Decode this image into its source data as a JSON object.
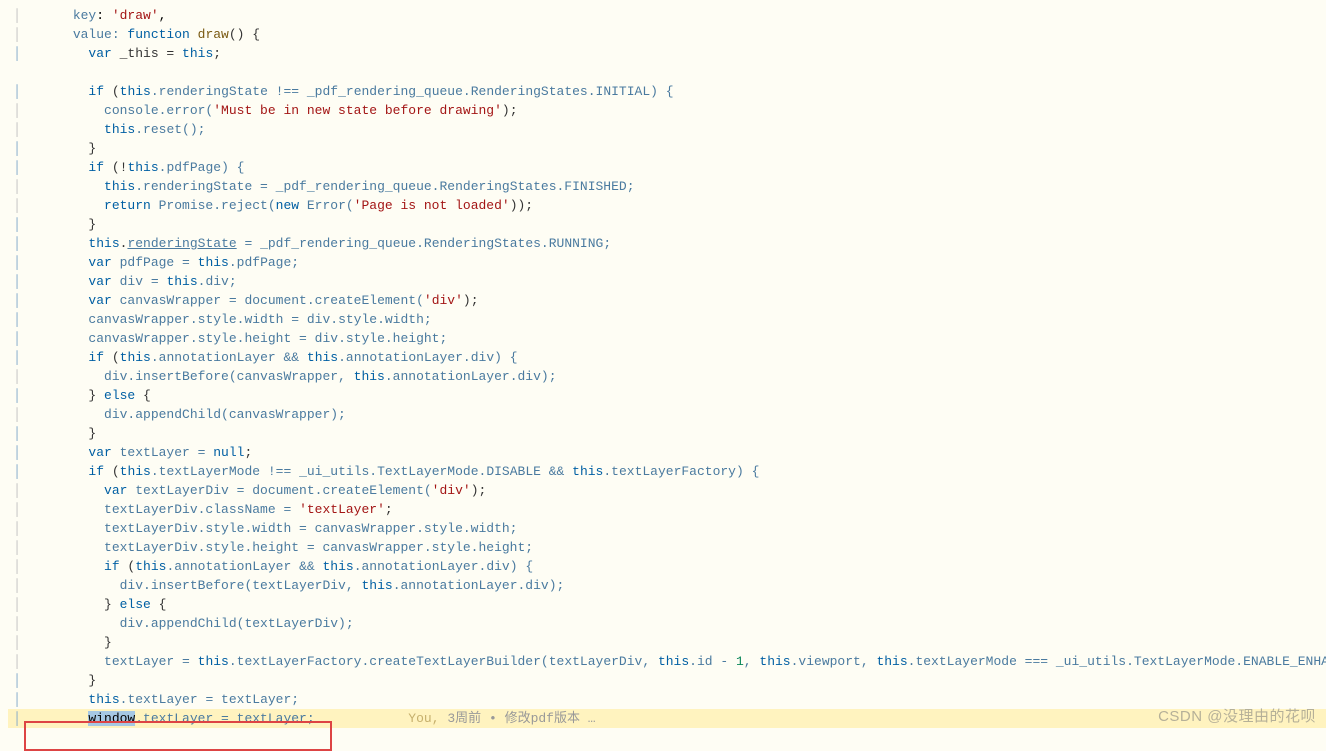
{
  "code": {
    "l1": "key: 'draw',",
    "l2a": "value: ",
    "l2b": "function",
    "l2c": " draw() {",
    "l3a": "var",
    "l3b": " _this = ",
    "l3c": "this",
    "l3d": ";",
    "l4": "",
    "l5a": "if",
    "l5b": " (",
    "l5c": "this",
    "l5d": ".renderingState !== _pdf_rendering_queue.RenderingStates.INITIAL) {",
    "l6a": "console.error(",
    "l6b": "'Must be in new state before drawing'",
    "l6c": ");",
    "l7a": "this",
    "l7b": ".reset();",
    "l8": "}",
    "l9a": "if",
    "l9b": " (!",
    "l9c": "this",
    "l9d": ".pdfPage) {",
    "l10a": "this",
    "l10b": ".renderingState = _pdf_rendering_queue.RenderingStates.FINISHED;",
    "l11a": "return",
    "l11b": " Promise.reject(",
    "l11c": "new",
    "l11d": " Error(",
    "l11e": "'Page is not loaded'",
    "l11f": "));",
    "l12": "}",
    "l13a": "this",
    "l13b": ".",
    "l13c": "renderingState",
    "l13d": " = _pdf_rendering_queue.RenderingStates.RUNNING;",
    "l14a": "var",
    "l14b": " pdfPage = ",
    "l14c": "this",
    "l14d": ".pdfPage;",
    "l15a": "var",
    "l15b": " div = ",
    "l15c": "this",
    "l15d": ".div;",
    "l16a": "var",
    "l16b": " canvasWrapper = document.createElement(",
    "l16c": "'div'",
    "l16d": ");",
    "l17": "canvasWrapper.style.width = div.style.width;",
    "l18": "canvasWrapper.style.height = div.style.height;",
    "l19a": "if",
    "l19b": " (",
    "l19c": "this",
    "l19d": ".annotationLayer && ",
    "l19e": "this",
    "l19f": ".annotationLayer.div) {",
    "l20a": "div.insertBefore(canvasWrapper, ",
    "l20b": "this",
    "l20c": ".annotationLayer.div);",
    "l21a": "} ",
    "l21b": "else",
    "l21c": " {",
    "l22": "div.appendChild(canvasWrapper);",
    "l23": "}",
    "l24a": "var",
    "l24b": " textLayer = ",
    "l24c": "null",
    "l24d": ";",
    "l25a": "if",
    "l25b": " (",
    "l25c": "this",
    "l25d": ".textLayerMode !== _ui_utils.TextLayerMode.DISABLE && ",
    "l25e": "this",
    "l25f": ".textLayerFactory) {",
    "l26a": "var",
    "l26b": " textLayerDiv = document.createElement(",
    "l26c": "'div'",
    "l26d": ");",
    "l27a": "textLayerDiv.className = ",
    "l27b": "'textLayer'",
    "l27c": ";",
    "l28": "textLayerDiv.style.width = canvasWrapper.style.width;",
    "l29": "textLayerDiv.style.height = canvasWrapper.style.height;",
    "l30a": "if",
    "l30b": " (",
    "l30c": "this",
    "l30d": ".annotationLayer && ",
    "l30e": "this",
    "l30f": ".annotationLayer.div) {",
    "l31a": "div.insertBefore(textLayerDiv, ",
    "l31b": "this",
    "l31c": ".annotationLayer.div);",
    "l32a": "} ",
    "l32b": "else",
    "l32c": " {",
    "l33": "div.appendChild(textLayerDiv);",
    "l34": "}",
    "l35a": "textLayer = ",
    "l35b": "this",
    "l35c": ".textLayerFactory.createTextLayerBuilder(textLayerDiv, ",
    "l35d": "this",
    "l35e": ".id - ",
    "l35f": "1",
    "l35g": ", ",
    "l35h": "this",
    "l35i": ".viewport, ",
    "l35j": "this",
    "l35k": ".textLayerMode === _ui_utils.TextLayerMode.ENABLE_ENHANCE);",
    "l36": "}",
    "l37a": "this",
    "l37b": ".textLayer = textLayer;",
    "l38a": "window",
    "l38b": ".textLayer = textLayer;",
    "annot_you": "You,",
    "annot_time": "3周前",
    "annot_dot": "•",
    "annot_msg": "修改pdf版本 …"
  },
  "watermark": "CSDN @没理由的花呗"
}
